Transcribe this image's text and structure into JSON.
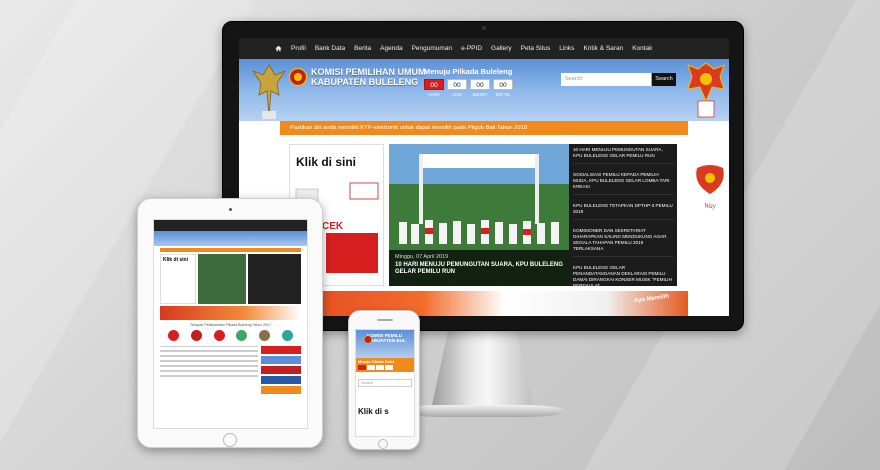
{
  "desktop": {
    "nav": {
      "items": [
        "Profil",
        "Bank Data",
        "Berita",
        "Agenda",
        "Pengumuman",
        "e-PPID",
        "Gallery",
        "Peta Situs",
        "Links",
        "Kritik & Saran",
        "Kontak"
      ]
    },
    "header": {
      "logo_line1": "KOMISI PEMILIHAN UMUM",
      "logo_line2": "KABUPATEN BULELENG",
      "countdown_title": "Menuju Pilkada Buleleng",
      "countdown_values": [
        "00",
        "00",
        "00",
        "00"
      ],
      "countdown_labels": [
        "HARI",
        "JAM",
        "MENIT",
        "DETIK"
      ],
      "search_placeholder": "Search",
      "search_button": "Search"
    },
    "notice": "Pastikan diri anda memiliki KTP-elektronik untuk dapat memilih pada Pilgub Bali Tahun 2018",
    "ad": {
      "title": "Klik di sini"
    },
    "slide": {
      "date": "Minggu, 07 April 2019",
      "title": "10 HARI MENUJU PEMUNGUTAN SUARA, KPU BULELENG GELAR PEMILU RUN"
    },
    "news": [
      "10 HARI MENUJU PEMUNGUTAN SUARA, KPU BULELENG GELAR PEMILU RUN",
      "SOSIALISASI PEMILU KEPADA PEMILIH MUDA, KPU BULELENG GELAR LOMBA TARI KREASI",
      "KPU BULELENG TETAPKAN DPTHP-3 PEMILU 2019",
      "KOMISIONER DAN SEKRETARIAT DIHARAPKAN SALING MENDUKUNG AGAR SEGALA TAHAPAN PEMILU 2019 TERLAKSANA",
      "KPU BULELENG GELAR PENANDATANGANAN DEKLARASI PEMILU DAMAI DIRANGKAI KONSER MUSIK \"PEMILIH BERDAULAT."
    ],
    "banner_right": "Ayo Memilih"
  },
  "tablet": {
    "ad_title": "Klik di sini",
    "subheading": "Tahapan Pelaksanaan Pilkada Buleleng Tahun 2017"
  },
  "phone": {
    "logo_line1": "KOMISI PEMILU",
    "logo_line2": "KABUPATEN BUL",
    "subtitle": "Menuju Pilkada Bulel",
    "search_placeholder": "Search",
    "ad_title": "Klik di s"
  },
  "colors": {
    "orange": "#f08a1d",
    "nav_dark": "#222222",
    "countdown_red": "#d62020",
    "header_blue": "#5b8fd6"
  }
}
